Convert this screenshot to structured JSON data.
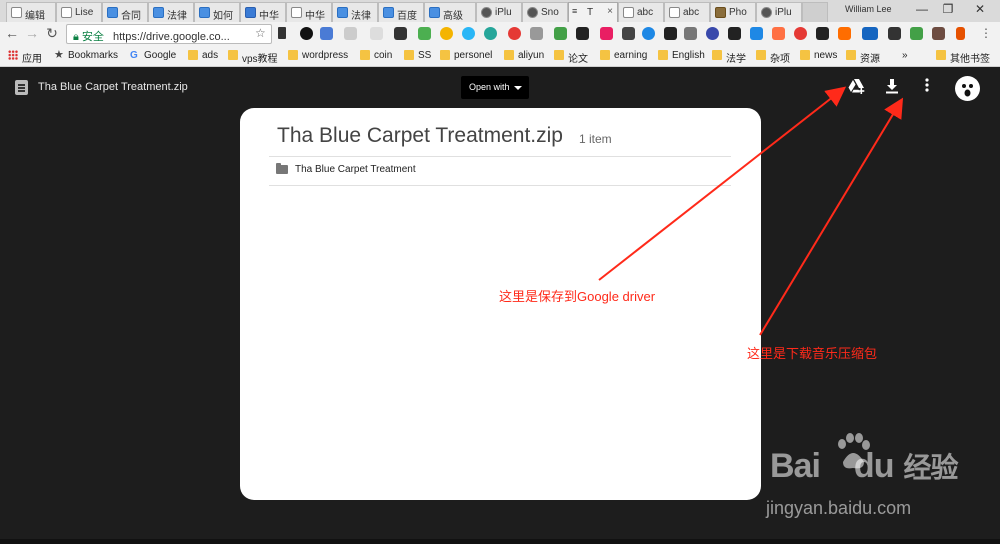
{
  "browser": {
    "tabs": [
      {
        "label": "编辑",
        "active": false
      },
      {
        "label": "Lise",
        "active": false
      },
      {
        "label": "合同",
        "active": false
      },
      {
        "label": "法律",
        "active": false
      },
      {
        "label": "如何",
        "active": false
      },
      {
        "label": "中华",
        "active": false
      },
      {
        "label": "中华",
        "active": false
      },
      {
        "label": "法律",
        "active": false
      },
      {
        "label": "百度",
        "active": false
      },
      {
        "label": "高级",
        "active": false
      },
      {
        "label": "iPlu",
        "active": false
      },
      {
        "label": "Sno",
        "active": false
      },
      {
        "label": "T",
        "active": true
      },
      {
        "label": "abc",
        "active": false
      },
      {
        "label": "abc",
        "active": false
      },
      {
        "label": "Pho",
        "active": false
      },
      {
        "label": "iPlu",
        "active": false
      }
    ],
    "user_name": "William Lee",
    "window_controls": {
      "minimize": "—",
      "restore": "❐",
      "close": "✕"
    },
    "address": {
      "secure_label": "安全",
      "url": "https://drive.google.co..."
    },
    "bookmarks": [
      {
        "label": "应用",
        "type": "apps"
      },
      {
        "label": "Bookmarks",
        "type": "star"
      },
      {
        "label": "Google",
        "type": "google"
      },
      {
        "label": "ads",
        "type": "folder"
      },
      {
        "label": "vps教程",
        "type": "folder"
      },
      {
        "label": "wordpress",
        "type": "folder"
      },
      {
        "label": "coin",
        "type": "folder"
      },
      {
        "label": "SS",
        "type": "folder"
      },
      {
        "label": "personel",
        "type": "folder"
      },
      {
        "label": "aliyun",
        "type": "folder"
      },
      {
        "label": "论文",
        "type": "folder"
      },
      {
        "label": "earning",
        "type": "folder"
      },
      {
        "label": "English",
        "type": "folder"
      },
      {
        "label": "法学",
        "type": "folder"
      },
      {
        "label": "杂项",
        "type": "folder"
      },
      {
        "label": "news",
        "type": "folder"
      },
      {
        "label": "资源",
        "type": "folder"
      },
      {
        "label": "»",
        "type": "overflow"
      },
      {
        "label": "其他书签",
        "type": "folder"
      }
    ]
  },
  "viewer": {
    "file_name": "Tha Blue Carpet Treatment.zip",
    "open_with_label": "Open with",
    "actions": {
      "add_to_drive": "add-to-drive-icon",
      "download": "download-icon",
      "more": "more-vert-icon"
    }
  },
  "zip_card": {
    "title": "Tha Blue Carpet Treatment.zip",
    "item_count": "1 item",
    "entries": [
      {
        "label": "Tha Blue Carpet Treatment",
        "icon": "folder-icon"
      }
    ]
  },
  "annotations": {
    "save_to_drive": "这里是保存到Google driver",
    "download_zip": "这里是下载音乐压缩包",
    "color": "#ff2a1a"
  },
  "watermark": {
    "logo": "Bai",
    "logo_tail": "du",
    "logo_cn": "经验",
    "url": "jingyan.baidu.com"
  }
}
